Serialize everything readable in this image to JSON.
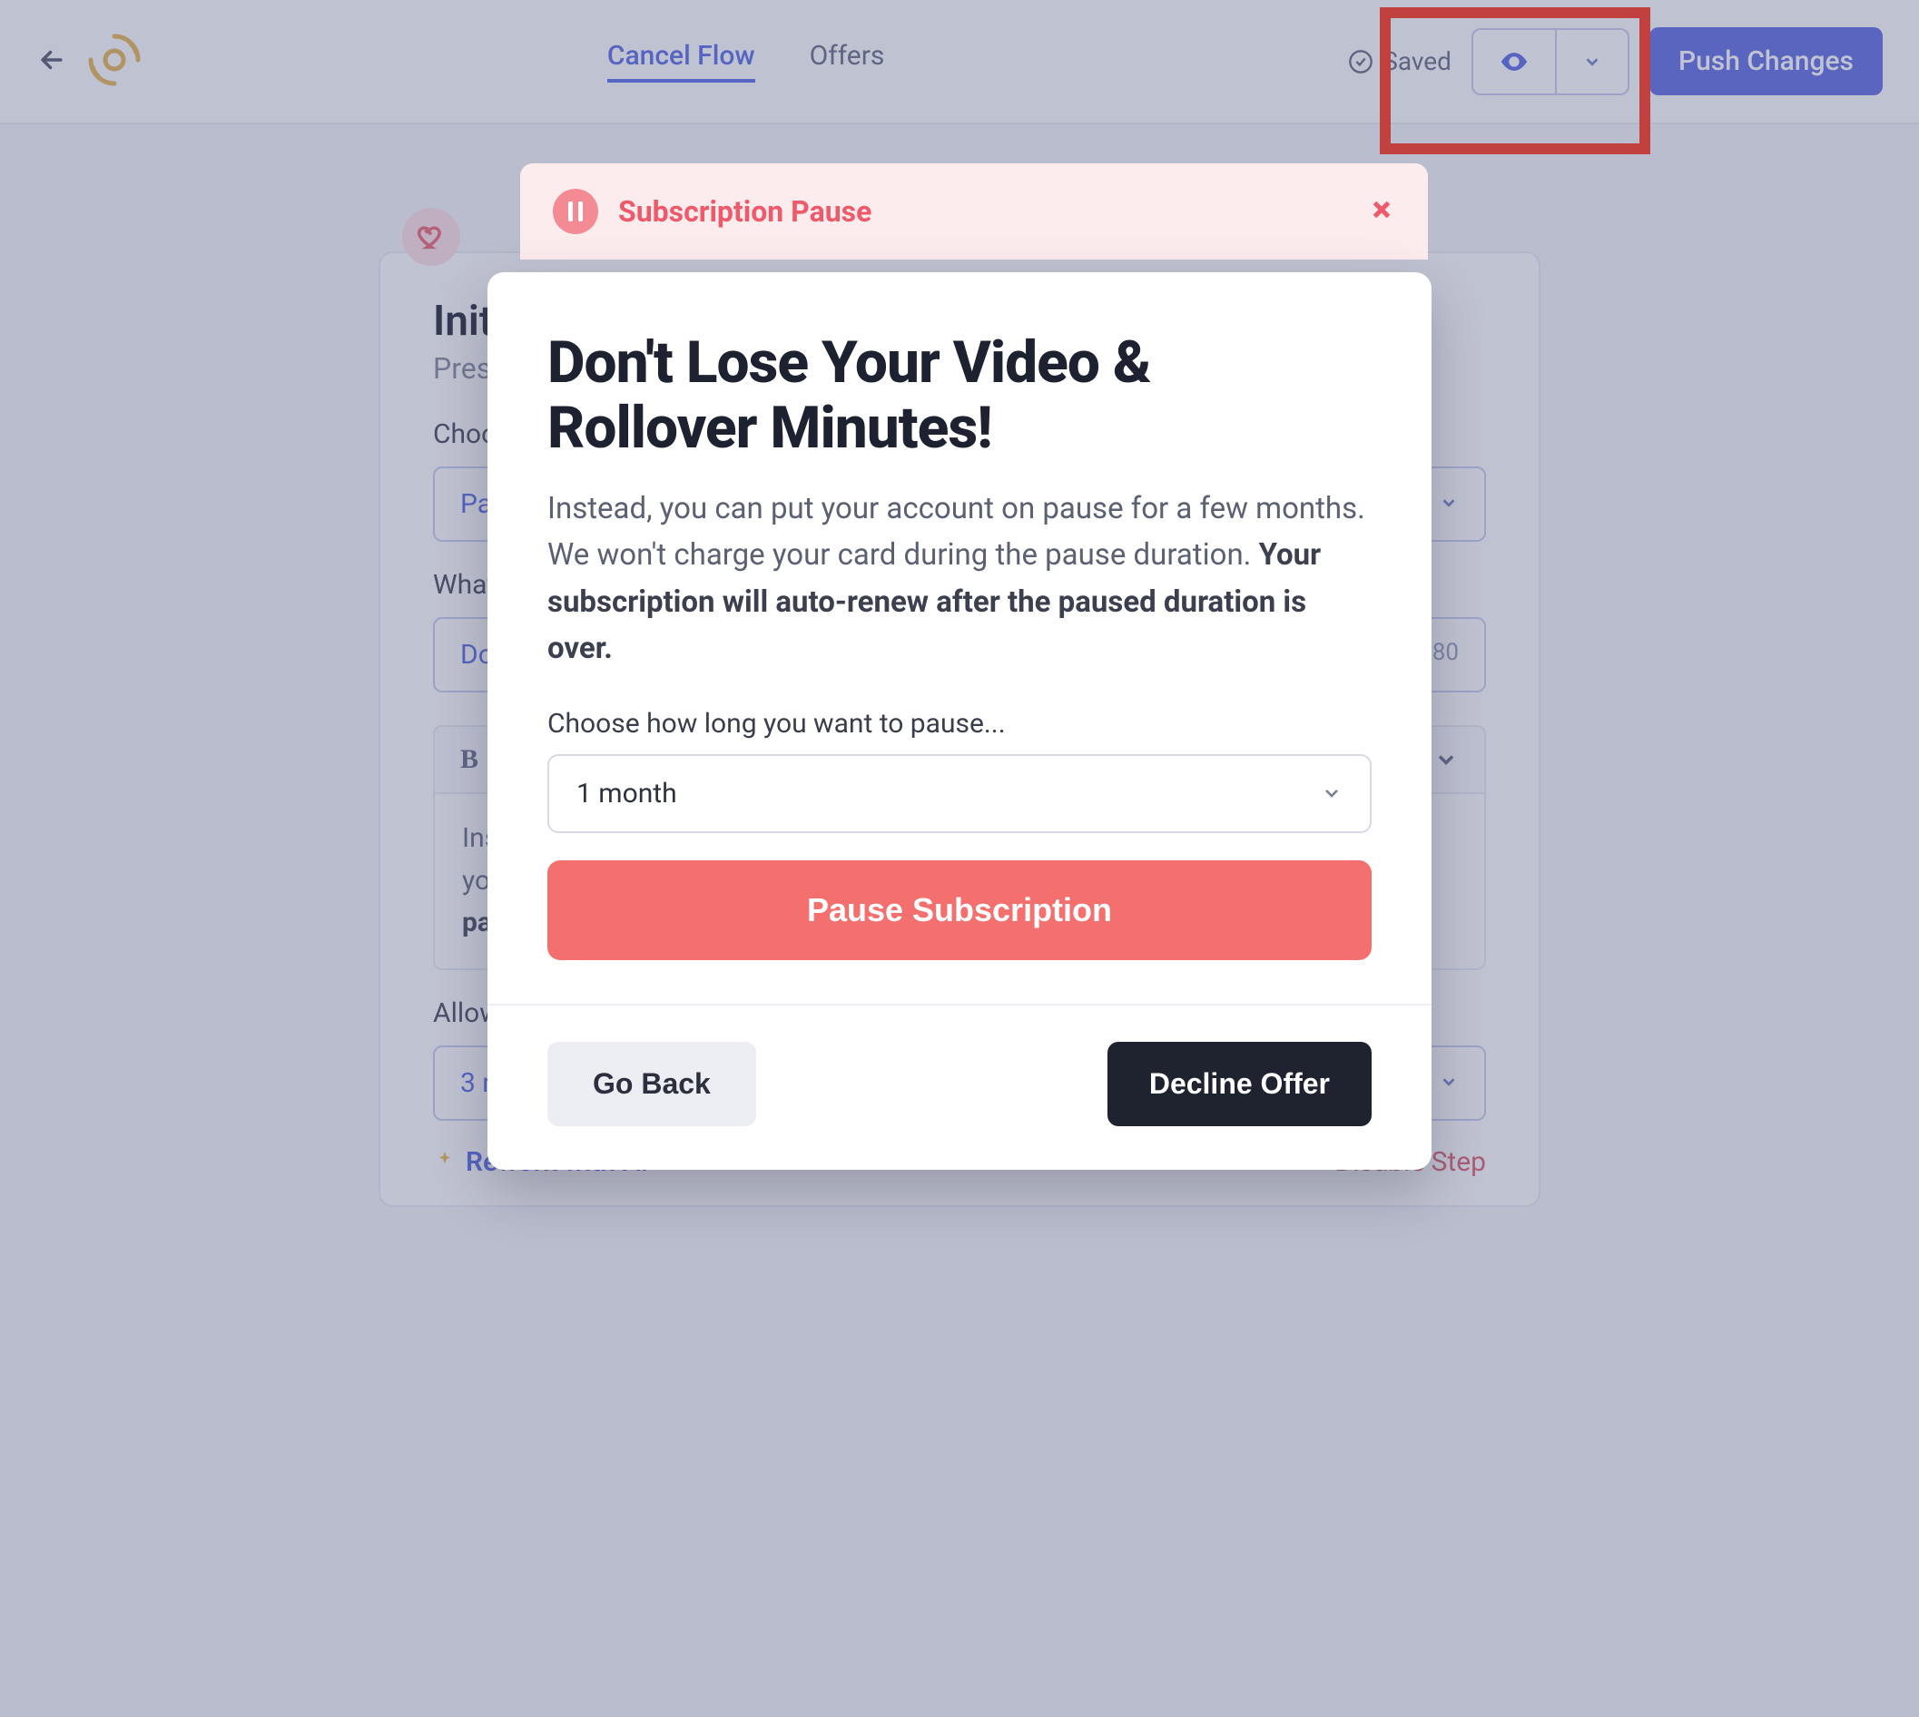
{
  "header": {
    "tabs": {
      "cancel_flow": "Cancel Flow",
      "offers": "Offers"
    },
    "saved_label": "Saved",
    "push_label": "Push Changes"
  },
  "editor": {
    "title": "Initi",
    "subtitle": "Prese",
    "choose_type_label": "Choos",
    "type_select_value": "Pau",
    "headline_label": "What",
    "headline_value": "Don",
    "headline_count": "41/80",
    "body_text_plain": "Instead, you can put your account on pause for a few months. We won't charge your card during the pause duration. ",
    "body_text_bold": "Your subscription will auto-renew after the paused duration is over.",
    "allow_label": "Allow subscriptions to pause up to…",
    "allow_value": "3 months",
    "rework_label": "Rework with AI",
    "disable_label": "Disable Step",
    "toolbar_body_size": "e"
  },
  "pink": {
    "title": "Subscription Pause"
  },
  "modal": {
    "heading": "Don't Lose Your Video & Rollover Minutes!",
    "body_plain": "Instead, you can put your account on pause for a few months. We won't charge your card during the pause duration. ",
    "body_bold": "Your subscription will auto-renew after the paused duration is over.",
    "choose_label": "Choose how long you want to pause...",
    "select_value": "1 month",
    "pause_btn": "Pause Subscription",
    "go_back": "Go Back",
    "decline": "Decline Offer"
  }
}
